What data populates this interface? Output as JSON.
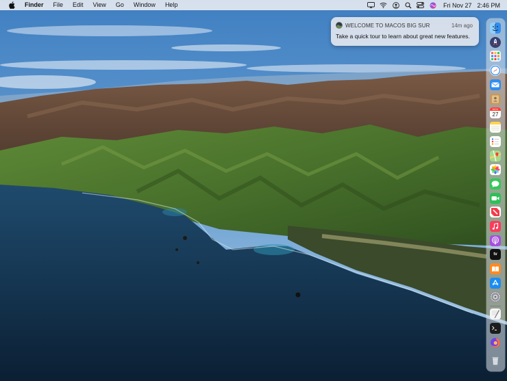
{
  "menubar": {
    "app_name": "Finder",
    "items": [
      "File",
      "Edit",
      "View",
      "Go",
      "Window",
      "Help"
    ],
    "status_icons": [
      "screen-mirroring-icon",
      "wifi-icon",
      "user-icon",
      "search-icon",
      "control-center-icon",
      "siri-icon"
    ],
    "date": "Fri Nov 27",
    "time": "2:46 PM"
  },
  "notification": {
    "title": "WELCOME TO MACOS BIG SUR",
    "time": "14m ago",
    "body": "Take a quick tour to learn about great new features."
  },
  "dock": {
    "apps": [
      {
        "name": "finder-icon",
        "color": "#3b9cf0"
      },
      {
        "name": "launchpad-icon",
        "color": "#3a3f6b"
      },
      {
        "name": "launchpad-grid-icon",
        "color": "#f2f2f2"
      },
      {
        "name": "safari-icon",
        "color": "#e9eef5"
      },
      {
        "name": "mail-icon",
        "color": "#2e8ef0"
      },
      {
        "name": "contacts-icon",
        "color": "#c59a5d"
      },
      {
        "name": "calendar-icon",
        "color": "#ffffff"
      },
      {
        "name": "notes-icon",
        "color": "#fbfbf6"
      },
      {
        "name": "reminders-icon",
        "color": "#ffffff"
      },
      {
        "name": "maps-icon",
        "color": "#7ec76b"
      },
      {
        "name": "photos-icon",
        "color": "#ffffff"
      },
      {
        "name": "messages-icon",
        "color": "#34c759"
      },
      {
        "name": "facetime-icon",
        "color": "#2fbf58"
      },
      {
        "name": "news-icon",
        "color": "#f43a4b"
      },
      {
        "name": "music-icon",
        "color": "#fb3c5a"
      },
      {
        "name": "podcasts-icon",
        "color": "#a550dd"
      },
      {
        "name": "tv-icon",
        "color": "#111111"
      },
      {
        "name": "books-icon",
        "color": "#ff8a1f"
      },
      {
        "name": "app-store-icon",
        "color": "#1b8cf2"
      },
      {
        "name": "system-preferences-icon",
        "color": "#8a8d92"
      },
      {
        "name": "textedit-icon",
        "color": "#f5f5f5"
      },
      {
        "name": "terminal-icon",
        "color": "#1c1c1c"
      },
      {
        "name": "firefox-icon",
        "color": "#ff7139"
      },
      {
        "name": "trash-icon",
        "color": "#d8dde4"
      }
    ],
    "calendar_month": "NOV",
    "calendar_day": "27",
    "tv_label": "tv"
  }
}
